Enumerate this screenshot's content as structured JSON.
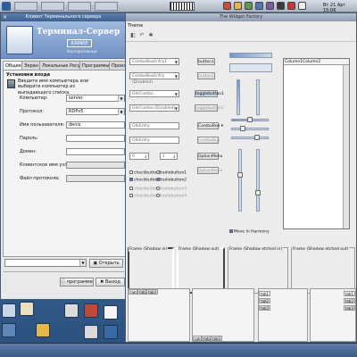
{
  "panel": {
    "clock": "Вт 21 Apr 15:06",
    "tasks": [
      "",
      "",
      "",
      ""
    ]
  },
  "terminal_window": {
    "title": "Клиент Терминального сервера",
    "close_glyph": "×",
    "logo_title": "Терминал-Сервер",
    "logo_box": "КАМИЛ",
    "logo_sub": "Корпоративный",
    "tabs": [
      "Общее",
      "Экран",
      "Локальные Ресурсы",
      "Программы",
      "Произ"
    ],
    "section_title": "Установки входа",
    "hint": "Введите имя компьютера или выберите компьютер из выпадающего списка.",
    "fields": [
      {
        "label": "Компьютер:",
        "value": "server",
        "dropdown": true,
        "disabled": false
      },
      {
        "label": "Протокол:",
        "value": "RDPv5",
        "dropdown": true,
        "disabled": false
      },
      {
        "label": "Имя пользователя:",
        "value": "denis",
        "dropdown": false,
        "disabled": false
      },
      {
        "label": "Пароль:",
        "value": "",
        "dropdown": false,
        "disabled": false
      },
      {
        "label": "Домен:",
        "value": "",
        "dropdown": false,
        "disabled": false
      },
      {
        "label": "Клиентское имя узла:",
        "value": "",
        "dropdown": false,
        "disabled": true
      },
      {
        "label": "Файл протокола:",
        "value": "",
        "dropdown": false,
        "disabled": true
      }
    ],
    "open_button": "Открыть",
    "about_button": "программе",
    "exit_button": "Выход"
  },
  "widget_window": {
    "title": "The Widget Factory",
    "menu_theme": "Theme",
    "toolbar_icons": [
      "◧",
      "↶",
      "✱"
    ],
    "combos": [
      {
        "text": "ComboBoxEntry1"
      },
      {
        "text": "ComboBoxEntry (Disabled)"
      },
      {
        "text": "GtkCombo"
      },
      {
        "text": "GtkCombo (Disabled)"
      },
      {
        "text": "GtkEntry"
      },
      {
        "text": "GtkEntry"
      }
    ],
    "buttons": [
      {
        "label": "button1",
        "pressed": false,
        "dim": false
      },
      {
        "label": "button2",
        "pressed": false,
        "dim": true
      },
      {
        "label": "togglebutton1",
        "pressed": true,
        "dim": false
      },
      {
        "label": "togglebutton2",
        "pressed": false,
        "dim": true
      },
      {
        "label": "ComboBox",
        "pressed": false,
        "dim": false
      },
      {
        "label": "ComboBox",
        "pressed": false,
        "dim": true
      },
      {
        "label": "OptionMenu",
        "pressed": false,
        "dim": false
      },
      {
        "label": "OptionMenu",
        "pressed": false,
        "dim": true
      }
    ],
    "spin_values": [
      "0",
      "1"
    ],
    "checks": [
      {
        "label": "checkbutton1",
        "kind": "check",
        "on": false,
        "dim": false
      },
      {
        "label": "radiobutton1",
        "kind": "radio",
        "on": false,
        "dim": false
      },
      {
        "label": "checkbutton2",
        "kind": "check",
        "on": true,
        "dim": false
      },
      {
        "label": "radiobutton2",
        "kind": "radio",
        "on": true,
        "dim": false
      },
      {
        "label": "checkbutton3",
        "kind": "check",
        "on": false,
        "dim": true
      },
      {
        "label": "radiobutton3",
        "kind": "radio",
        "on": false,
        "dim": true
      },
      {
        "label": "checkbutton4",
        "kind": "check",
        "on": false,
        "dim": true
      },
      {
        "label": "radiobutton4",
        "kind": "radio",
        "on": false,
        "dim": true
      }
    ],
    "harmony_label": "Move In Harmony",
    "textview_header": "Column1Column2",
    "frames": [
      {
        "label": "Frame (Shadow in)",
        "style": "in"
      },
      {
        "label": "Frame (Shadow out)",
        "style": "out"
      },
      {
        "label": "Frame (Shadow etched in)",
        "style": "etched"
      },
      {
        "label": "Frame (Shadow etched out)",
        "style": "etched"
      }
    ],
    "notebook_tabs": [
      "tab1",
      "tab2",
      "tab3"
    ]
  }
}
